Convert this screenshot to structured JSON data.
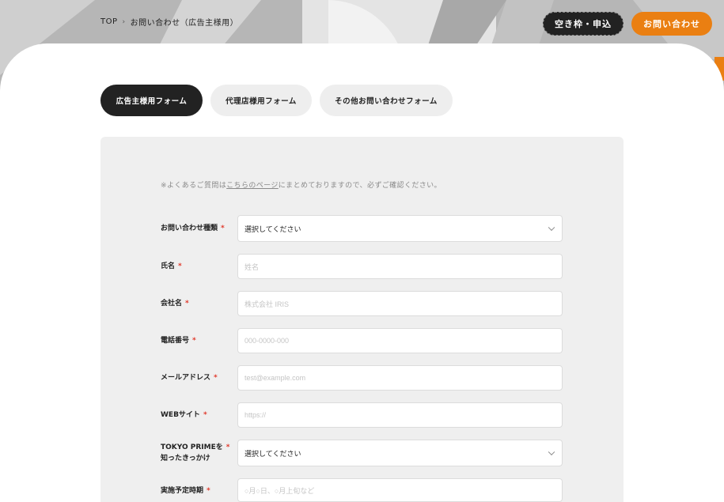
{
  "colors": {
    "accent": "#ea7f12",
    "dark": "#222222",
    "required": "#e0392b",
    "formBg": "#efefef"
  },
  "breadcrumb": {
    "home": "TOP",
    "separator": "›",
    "current": "お問い合わせ（広告主様用）"
  },
  "header": {
    "slot_button": "空き枠・申込",
    "contact_button": "お問い合わせ"
  },
  "tabs": [
    {
      "label": "広告主様用フォーム",
      "active": true
    },
    {
      "label": "代理店様用フォーム",
      "active": false
    },
    {
      "label": "その他お問い合わせフォーム",
      "active": false
    }
  ],
  "notice": {
    "prefix": "※よくあるご質問は",
    "link": "こちらのページ",
    "suffix": "にまとめておりますので、必ずご確認ください。"
  },
  "required_mark": "*",
  "form": {
    "inquiry_type": {
      "label": "お問い合わせ種類",
      "value": "選択してください"
    },
    "name": {
      "label": "氏名",
      "placeholder": "姓名"
    },
    "company": {
      "label": "会社名",
      "placeholder": "株式会社 IRIS"
    },
    "phone": {
      "label": "電話番号",
      "placeholder": "000-0000-000"
    },
    "email": {
      "label": "メールアドレス",
      "placeholder": "test@example.com"
    },
    "website": {
      "label": "WEBサイト",
      "placeholder": "https://"
    },
    "source": {
      "label_line1": "TOKYO PRIMEを",
      "label_line2": "知ったきっかけ",
      "value": "選択してください"
    },
    "schedule": {
      "label": "実施予定時期",
      "placeholder": "○月○日、○月上旬など"
    }
  }
}
